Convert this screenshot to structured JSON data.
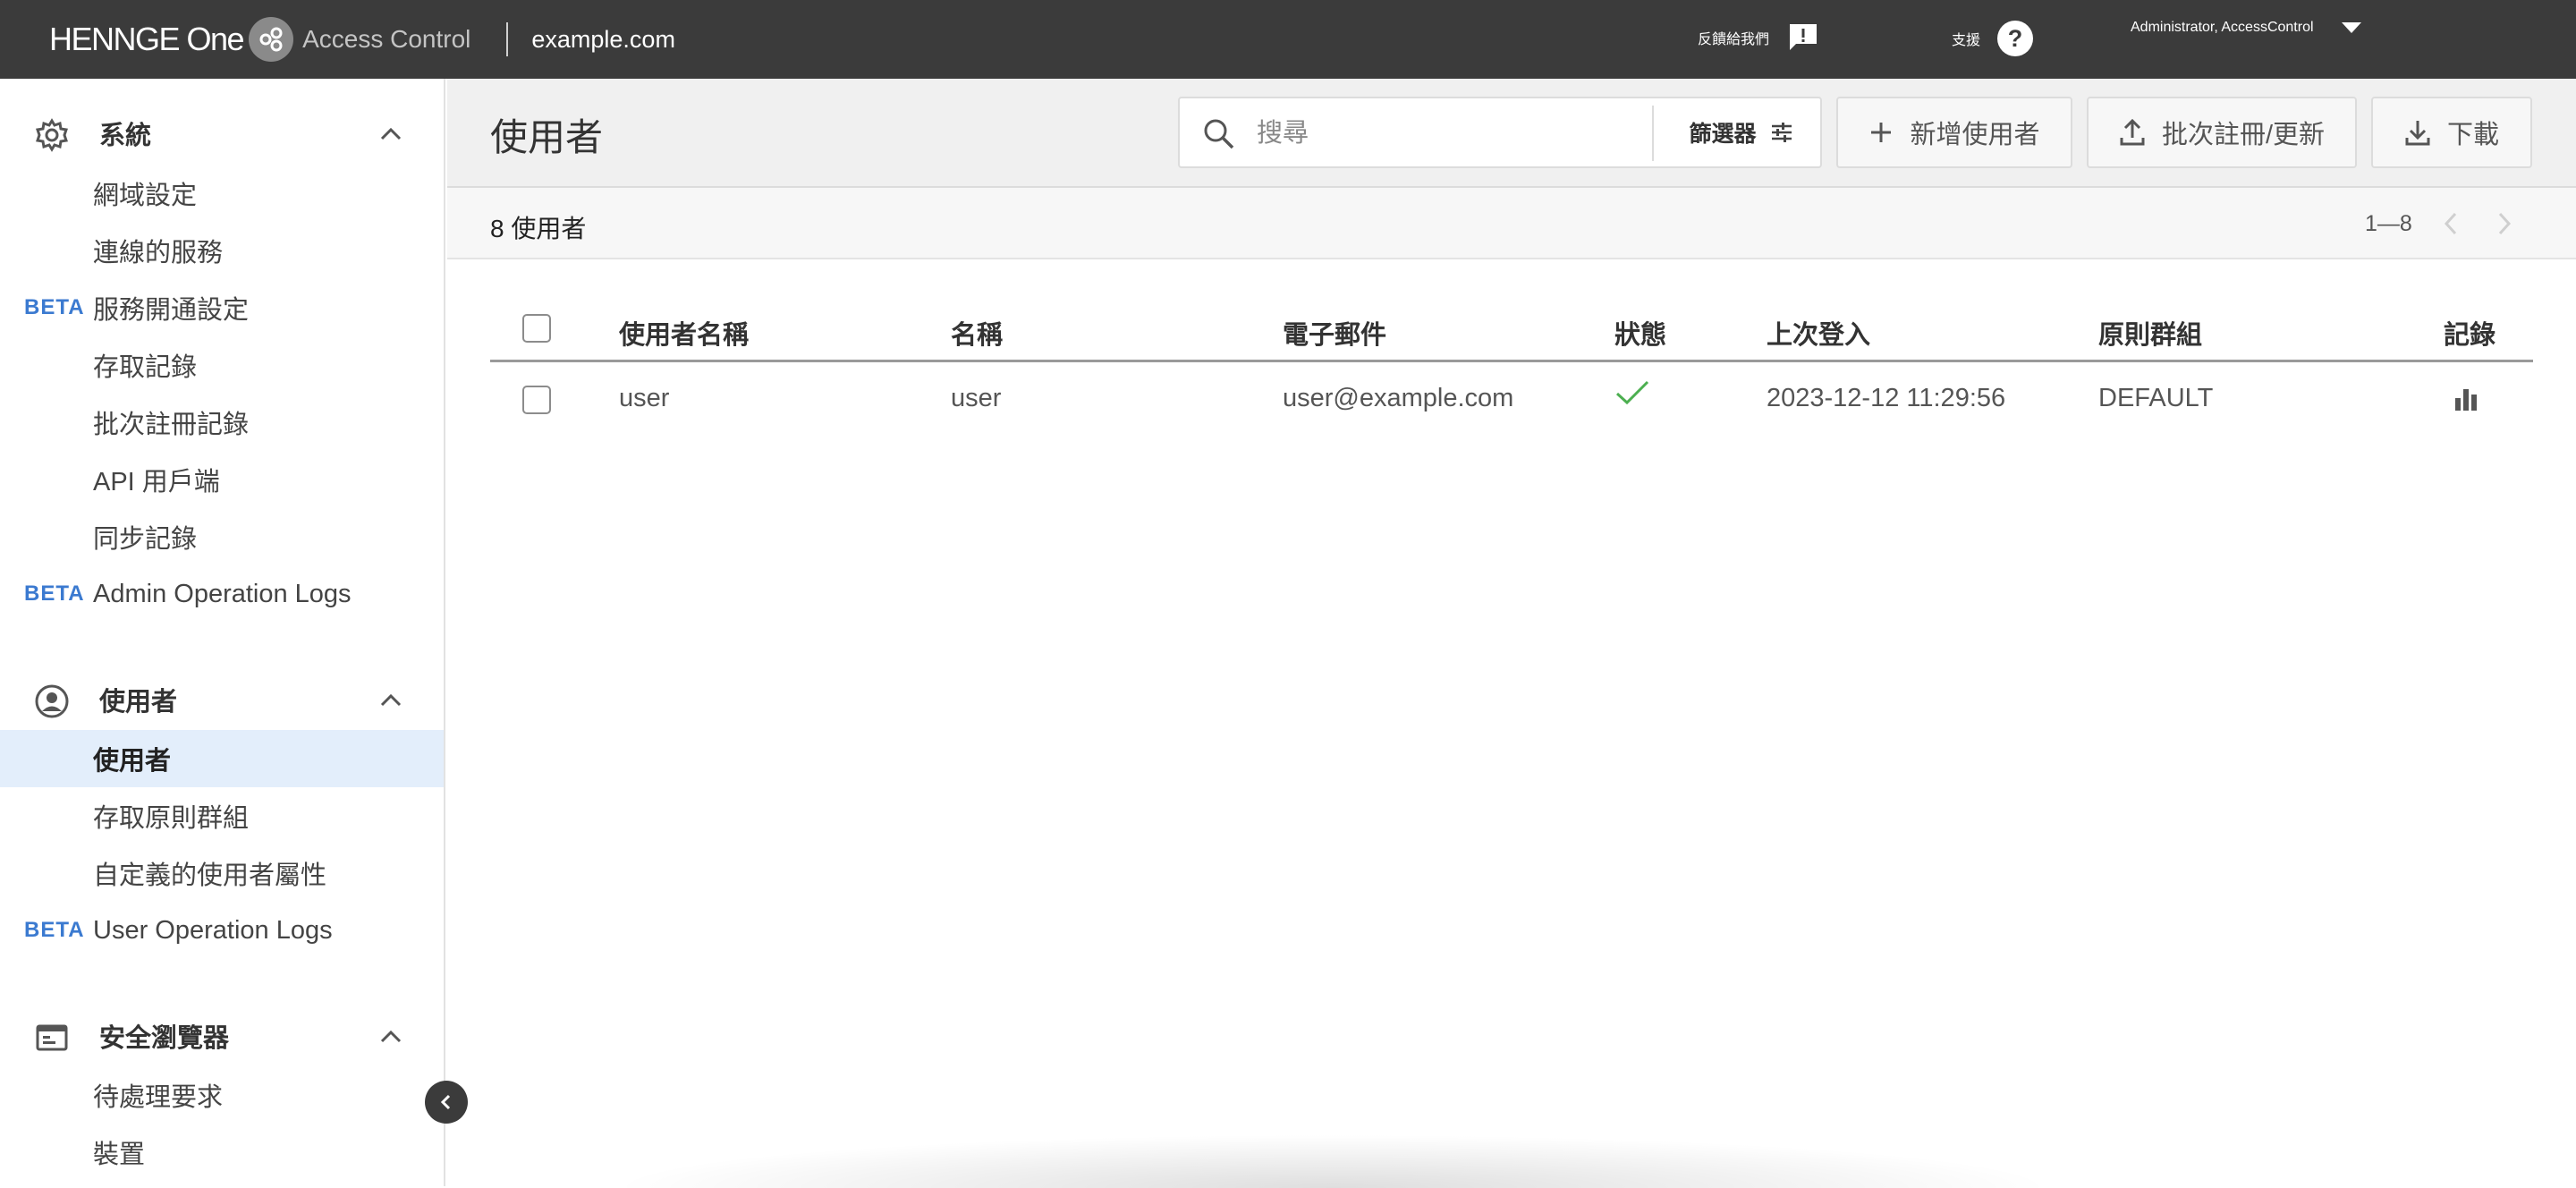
{
  "topbar": {
    "brand_name": "HENNGE One",
    "product": "Access Control",
    "domain": "example.com",
    "feedback_label": "反饋給我們",
    "support_label": "支援",
    "user_label": "Administrator, AccessControl"
  },
  "sidebar": {
    "system": {
      "title": "系統",
      "items": [
        {
          "label": "網域設定",
          "beta": ""
        },
        {
          "label": "連線的服務",
          "beta": ""
        },
        {
          "label": "服務開通設定",
          "beta": "BETA"
        },
        {
          "label": "存取記錄",
          "beta": ""
        },
        {
          "label": "批次註冊記錄",
          "beta": ""
        },
        {
          "label": "API 用戶端",
          "beta": ""
        },
        {
          "label": "同步記錄",
          "beta": ""
        },
        {
          "label": "Admin Operation Logs",
          "beta": "BETA"
        }
      ]
    },
    "users": {
      "title": "使用者",
      "items": [
        {
          "label": "使用者",
          "beta": "",
          "active": true
        },
        {
          "label": "存取原則群組",
          "beta": ""
        },
        {
          "label": "自定義的使用者屬性",
          "beta": ""
        },
        {
          "label": "User Operation Logs",
          "beta": "BETA"
        }
      ]
    },
    "browser": {
      "title": "安全瀏覽器",
      "items": [
        {
          "label": "待處理要求",
          "beta": ""
        },
        {
          "label": "裝置",
          "beta": ""
        }
      ]
    }
  },
  "main": {
    "title": "使用者",
    "search_placeholder": "搜尋",
    "filter_label": "篩選器",
    "add_user_label": "新增使用者",
    "bulk_label": "批次註冊/更新",
    "download_label": "下載",
    "count_label": "8 使用者",
    "pager_label": "1—8"
  },
  "table": {
    "columns": [
      "使用者名稱",
      "名稱",
      "電子郵件",
      "狀態",
      "上次登入",
      "原則群組",
      "記錄"
    ],
    "rows": [
      {
        "username": "user",
        "name": "user",
        "email": "user@example.com",
        "status": "active",
        "last_login": "2023-12-12 11:29:56",
        "policy_group": "DEFAULT"
      }
    ]
  },
  "colors": {
    "topbar": "#3b3b3b",
    "beta": "#3b7ad0",
    "active_bg": "#e3eefb",
    "status_ok": "#4caf50"
  }
}
